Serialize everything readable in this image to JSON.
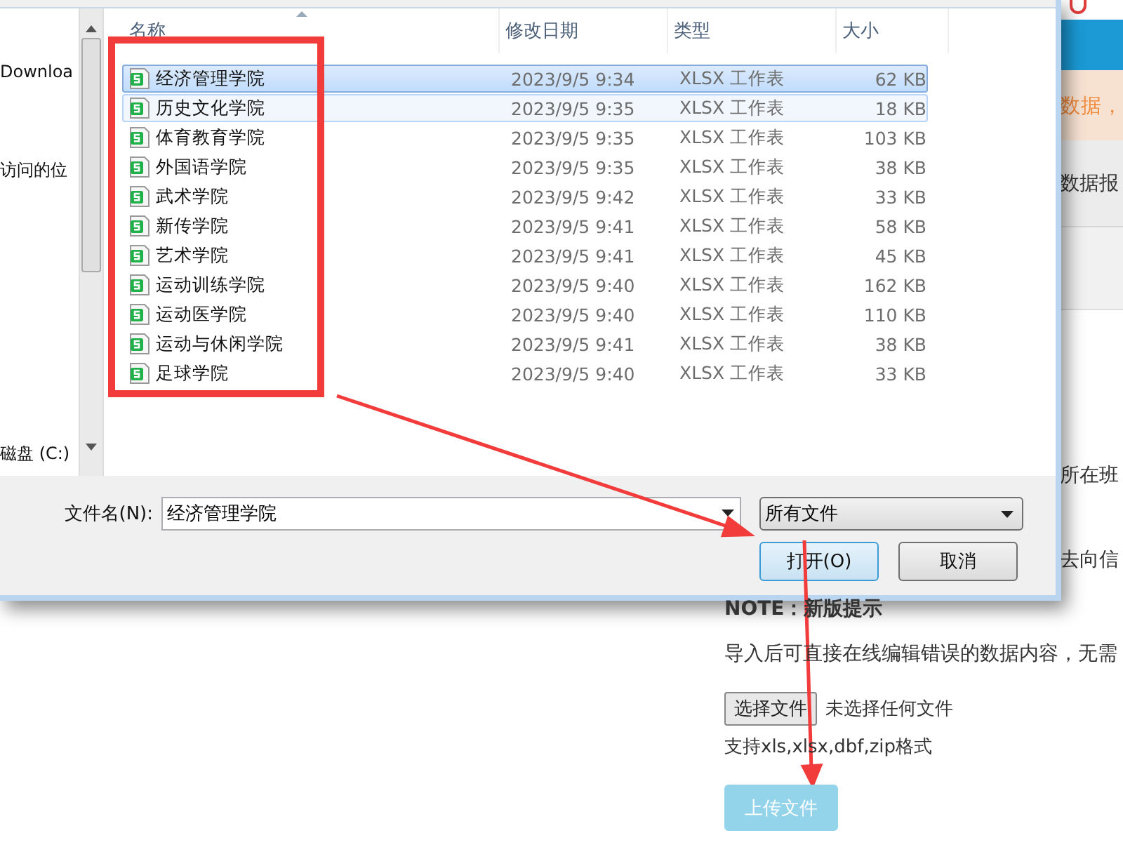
{
  "dialog": {
    "nav_items": [
      {
        "label": "Downloa"
      },
      {
        "label": "访问的位"
      },
      {
        "label": "磁盘 (C:)"
      }
    ],
    "columns": [
      "名称",
      "修改日期",
      "类型",
      "大小"
    ],
    "files": [
      {
        "name": "经济管理学院",
        "modified": "2023/9/5 9:34",
        "type": "XLSX 工作表",
        "size": "62 KB",
        "selected": true,
        "hovered": false
      },
      {
        "name": "历史文化学院",
        "modified": "2023/9/5 9:35",
        "type": "XLSX 工作表",
        "size": "18 KB",
        "selected": false,
        "hovered": true
      },
      {
        "name": "体育教育学院",
        "modified": "2023/9/5 9:35",
        "type": "XLSX 工作表",
        "size": "103 KB",
        "selected": false,
        "hovered": false
      },
      {
        "name": "外国语学院",
        "modified": "2023/9/5 9:35",
        "type": "XLSX 工作表",
        "size": "38 KB",
        "selected": false,
        "hovered": false
      },
      {
        "name": "武术学院",
        "modified": "2023/9/5 9:42",
        "type": "XLSX 工作表",
        "size": "33 KB",
        "selected": false,
        "hovered": false
      },
      {
        "name": "新传学院",
        "modified": "2023/9/5 9:41",
        "type": "XLSX 工作表",
        "size": "58 KB",
        "selected": false,
        "hovered": false
      },
      {
        "name": "艺术学院",
        "modified": "2023/9/5 9:41",
        "type": "XLSX 工作表",
        "size": "45 KB",
        "selected": false,
        "hovered": false
      },
      {
        "name": "运动训练学院",
        "modified": "2023/9/5 9:40",
        "type": "XLSX 工作表",
        "size": "162 KB",
        "selected": false,
        "hovered": false
      },
      {
        "name": "运动医学院",
        "modified": "2023/9/5 9:40",
        "type": "XLSX 工作表",
        "size": "110 KB",
        "selected": false,
        "hovered": false
      },
      {
        "name": "运动与休闲学院",
        "modified": "2023/9/5 9:41",
        "type": "XLSX 工作表",
        "size": "38 KB",
        "selected": false,
        "hovered": false
      },
      {
        "name": "足球学院",
        "modified": "2023/9/5 9:40",
        "type": "XLSX 工作表",
        "size": "33 KB",
        "selected": false,
        "hovered": false
      }
    ],
    "filename_label": "文件名(N):",
    "filename": "经济管理学院",
    "file_type": "所有文件",
    "buttons": [
      {
        "label": "打开(O)",
        "default": true
      },
      {
        "label": "取消",
        "default": false
      }
    ]
  },
  "page": {
    "notice_fragment": "数据，",
    "tab_fragment": "数据报",
    "row_fragments": [
      "所在班",
      "去向信"
    ],
    "note_title": "NOTE：新版提示",
    "note_text": "导入后可直接在线编辑错误的数据内容，无需",
    "choose_button": "选择文件",
    "no_file_text": "未选择任何文件",
    "formats_text": "支持xls,xlsx,dbf,zip格式",
    "upload_button": {
      "label": "上传文件",
      "disabled": true
    }
  }
}
